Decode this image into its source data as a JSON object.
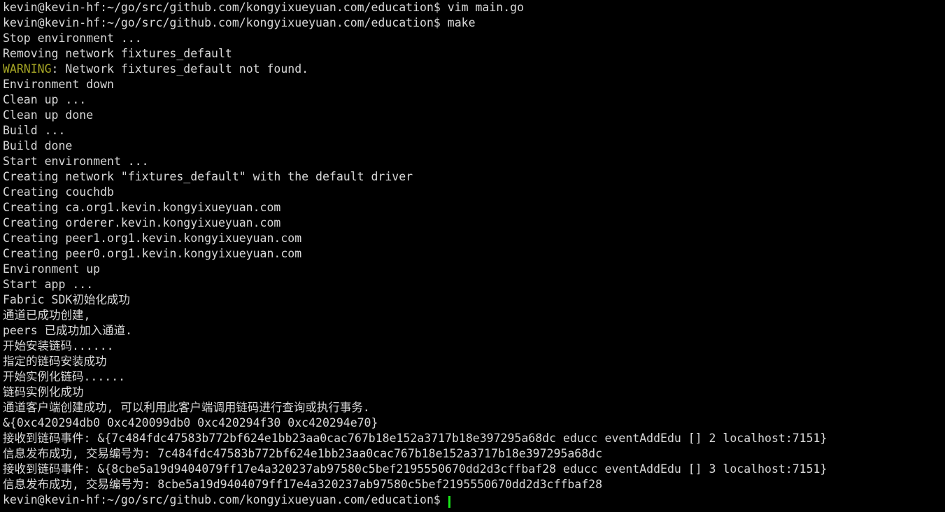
{
  "terminal": {
    "background_color": "#000000",
    "foreground_color": "#d8d8d8",
    "warning_color": "#a6a625",
    "cursor_color": "#19e619",
    "prompt": "kevin@kevin-hf:~/go/src/github.com/kongyixueyuan.com/education$",
    "lines": [
      {
        "id": "line-1",
        "text": "kevin@kevin-hf:~/go/src/github.com/kongyixueyuan.com/education$ vim main.go"
      },
      {
        "id": "line-2",
        "text": "kevin@kevin-hf:~/go/src/github.com/kongyixueyuan.com/education$ make"
      },
      {
        "id": "line-3",
        "text": "Stop environment ..."
      },
      {
        "id": "line-4",
        "text": "Removing network fixtures_default"
      },
      {
        "id": "line-5",
        "warning_prefix": "WARNING",
        "text": ": Network fixtures_default not found."
      },
      {
        "id": "line-6",
        "text": "Environment down"
      },
      {
        "id": "line-7",
        "text": "Clean up ..."
      },
      {
        "id": "line-8",
        "text": "Clean up done"
      },
      {
        "id": "line-9",
        "text": "Build ..."
      },
      {
        "id": "line-10",
        "text": "Build done"
      },
      {
        "id": "line-11",
        "text": "Start environment ..."
      },
      {
        "id": "line-12",
        "text": "Creating network \"fixtures_default\" with the default driver"
      },
      {
        "id": "line-13",
        "text": "Creating couchdb"
      },
      {
        "id": "line-14",
        "text": "Creating ca.org1.kevin.kongyixueyuan.com"
      },
      {
        "id": "line-15",
        "text": "Creating orderer.kevin.kongyixueyuan.com"
      },
      {
        "id": "line-16",
        "text": "Creating peer1.org1.kevin.kongyixueyuan.com"
      },
      {
        "id": "line-17",
        "text": "Creating peer0.org1.kevin.kongyixueyuan.com"
      },
      {
        "id": "line-18",
        "text": "Environment up"
      },
      {
        "id": "line-19",
        "text": "Start app ..."
      },
      {
        "id": "line-20",
        "text": "Fabric SDK初始化成功"
      },
      {
        "id": "line-21",
        "text": "通道已成功创建,"
      },
      {
        "id": "line-22",
        "text": "peers 已成功加入通道."
      },
      {
        "id": "line-23",
        "text": "开始安装链码......"
      },
      {
        "id": "line-24",
        "text": "指定的链码安装成功"
      },
      {
        "id": "line-25",
        "text": "开始实例化链码......"
      },
      {
        "id": "line-26",
        "text": "链码实例化成功"
      },
      {
        "id": "line-27",
        "text": "通道客户端创建成功, 可以利用此客户端调用链码进行查询或执行事务."
      },
      {
        "id": "line-28",
        "text": "&{0xc420294db0 0xc420099db0 0xc420294f30 0xc420294e70}"
      },
      {
        "id": "line-29",
        "text": "接收到链码事件: &{7c484fdc47583b772bf624e1bb23aa0cac767b18e152a3717b18e397295a68dc educc eventAddEdu [] 2 localhost:7151}"
      },
      {
        "id": "line-30",
        "text": "信息发布成功, 交易编号为: 7c484fdc47583b772bf624e1bb23aa0cac767b18e152a3717b18e397295a68dc"
      },
      {
        "id": "line-31",
        "text": "接收到链码事件: &{8cbe5a19d9404079ff17e4a320237ab97580c5bef2195550670dd2d3cffbaf28 educc eventAddEdu [] 3 localhost:7151}"
      },
      {
        "id": "line-32",
        "text": "信息发布成功, 交易编号为: 8cbe5a19d9404079ff17e4a320237ab97580c5bef2195550670dd2d3cffbaf28"
      },
      {
        "id": "line-33",
        "text": "kevin@kevin-hf:~/go/src/github.com/kongyixueyuan.com/education$ ",
        "cursor": true
      }
    ]
  }
}
